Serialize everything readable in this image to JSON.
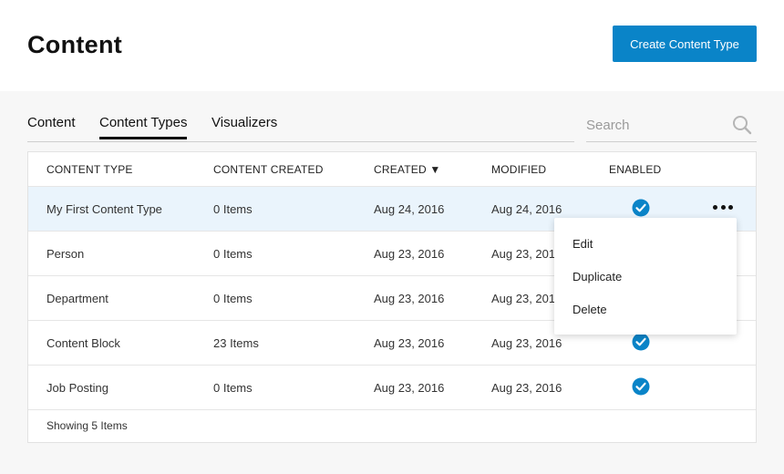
{
  "header": {
    "title": "Content",
    "create_button": "Create Content Type"
  },
  "tabs": [
    {
      "label": "Content",
      "active": false
    },
    {
      "label": "Content Types",
      "active": true
    },
    {
      "label": "Visualizers",
      "active": false
    }
  ],
  "search": {
    "placeholder": "Search",
    "value": "",
    "icon": "search-icon"
  },
  "table": {
    "columns": [
      "CONTENT TYPE",
      "CONTENT CREATED",
      "CREATED ▼",
      "MODIFIED",
      "ENABLED"
    ],
    "sorted_column": "CREATED",
    "sort_direction": "descending",
    "rows": [
      {
        "name": "My First Content Type",
        "content_created": "0 Items",
        "created": "Aug 24, 2016",
        "modified": "Aug 24, 2016",
        "enabled": true
      },
      {
        "name": "Person",
        "content_created": "0 Items",
        "created": "Aug 23, 2016",
        "modified": "Aug 23, 2016",
        "enabled": true
      },
      {
        "name": "Department",
        "content_created": "0 Items",
        "created": "Aug 23, 2016",
        "modified": "Aug 23, 2016",
        "enabled": true
      },
      {
        "name": "Content Block",
        "content_created": "23 Items",
        "created": "Aug 23, 2016",
        "modified": "Aug 23, 2016",
        "enabled": true
      },
      {
        "name": "Job Posting",
        "content_created": "0 Items",
        "created": "Aug 23, 2016",
        "modified": "Aug 23, 2016",
        "enabled": true
      }
    ],
    "footer": "Showing 5 Items"
  },
  "row_menu": {
    "items": [
      "Edit",
      "Duplicate",
      "Delete"
    ]
  },
  "colors": {
    "accent": "#0a84c8",
    "highlight_row": "#eaf4fc",
    "page_background": "#f7f7f7"
  }
}
